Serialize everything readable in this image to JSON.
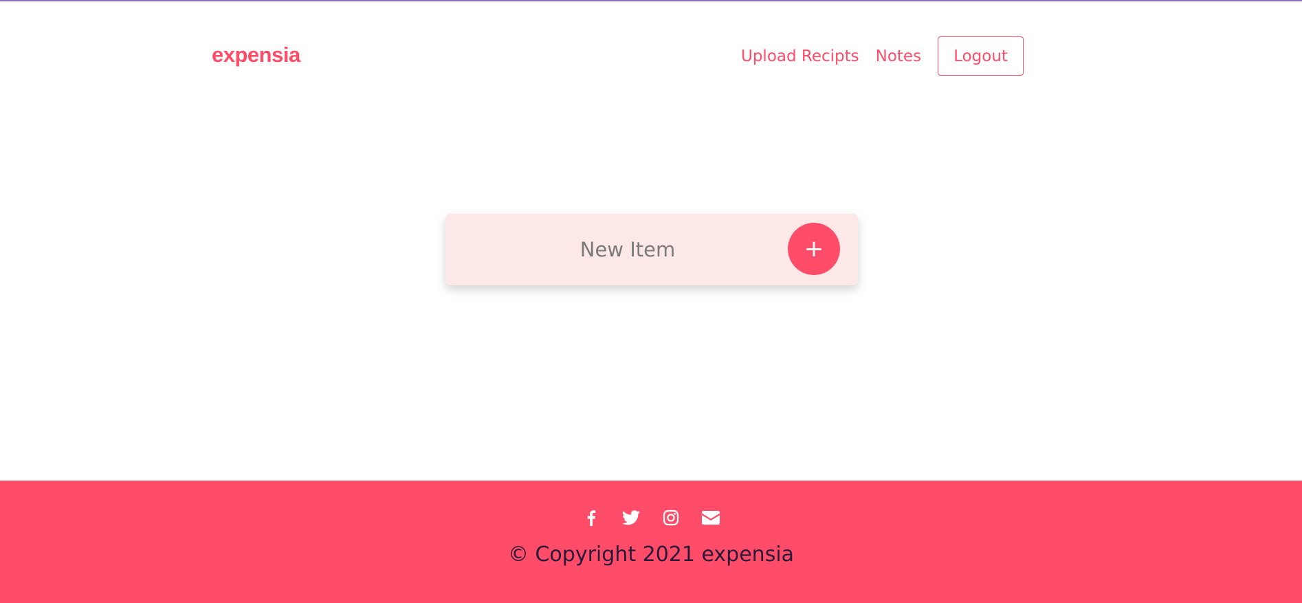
{
  "header": {
    "brand": "expensia",
    "nav": {
      "upload_label": "Upload Recipts",
      "notes_label": "Notes",
      "logout_label": "Logout"
    }
  },
  "main": {
    "new_item_placeholder": "New Item",
    "add_button_label": "+"
  },
  "footer": {
    "social_icons": [
      "facebook-icon",
      "twitter-icon",
      "instagram-icon",
      "envelope-icon"
    ],
    "copyright": "© Copyright 2021 expensia"
  },
  "colors": {
    "accent": "#ff4c68",
    "card_background": "#fde8e8",
    "top_line": "#8f6fb8",
    "copyright_text": "#2a1a3a"
  }
}
